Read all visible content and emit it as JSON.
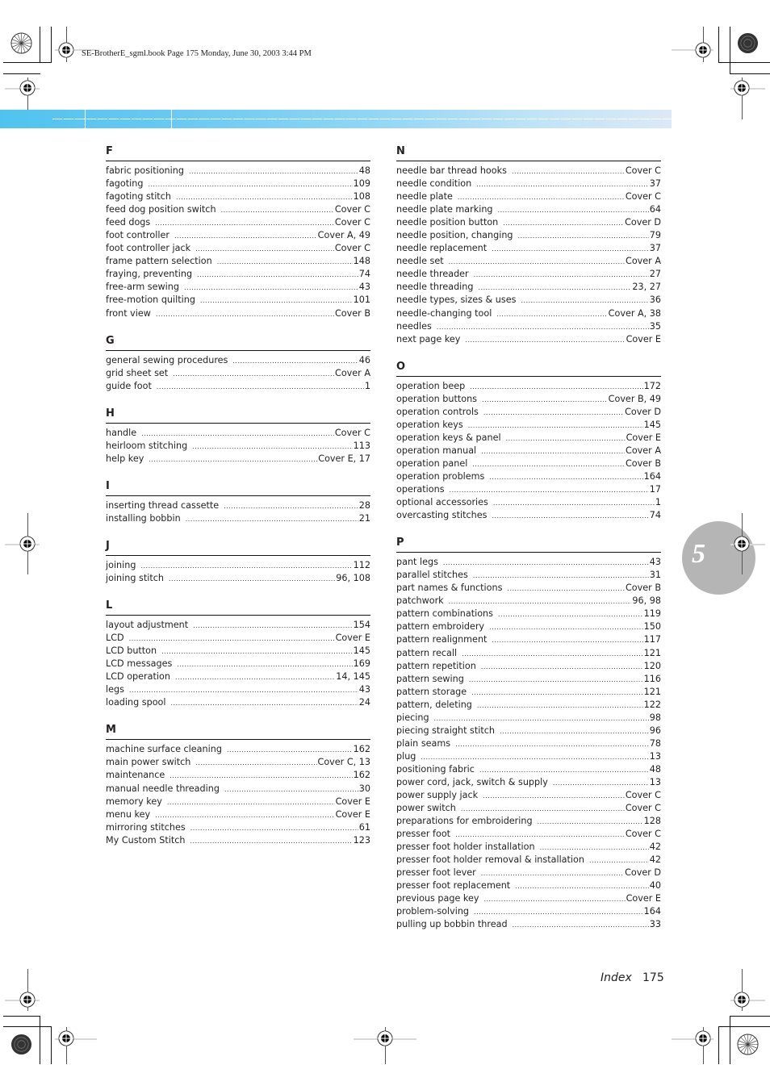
{
  "header": {
    "meta": "SE-BrotherE_sgml.book  Page 175  Monday, June 30, 2003  3:44 PM"
  },
  "chapter_tab": {
    "number": "5",
    "color": "#b5b5b6"
  },
  "band_colors": {
    "start": "#4fc3f0",
    "end": "#dbe9f7"
  },
  "footer": {
    "label": "Index",
    "page_number": "175"
  },
  "index": {
    "left": [
      {
        "letter": "F",
        "entries": [
          {
            "term": "fabric positioning",
            "page": "48"
          },
          {
            "term": "fagoting",
            "page": "109"
          },
          {
            "term": "fagoting stitch",
            "page": "108"
          },
          {
            "term": "feed dog position switch",
            "page": "Cover C"
          },
          {
            "term": "feed dogs",
            "page": "Cover C"
          },
          {
            "term": "foot controller",
            "page": "Cover A, 49"
          },
          {
            "term": "foot controller jack",
            "page": "Cover C"
          },
          {
            "term": "frame pattern selection",
            "page": "148"
          },
          {
            "term": "fraying, preventing",
            "page": "74"
          },
          {
            "term": "free-arm sewing",
            "page": "43"
          },
          {
            "term": "free-motion quilting",
            "page": "101"
          },
          {
            "term": "front view",
            "page": "Cover B"
          }
        ]
      },
      {
        "letter": "G",
        "entries": [
          {
            "term": "general sewing procedures",
            "page": "46"
          },
          {
            "term": "grid sheet set",
            "page": "Cover A"
          },
          {
            "term": "guide foot",
            "page": "1"
          }
        ]
      },
      {
        "letter": "H",
        "entries": [
          {
            "term": "handle",
            "page": "Cover C"
          },
          {
            "term": "heirloom stitching",
            "page": "113"
          },
          {
            "term": "help key",
            "page": "Cover E, 17"
          }
        ]
      },
      {
        "letter": "I",
        "entries": [
          {
            "term": "inserting thread cassette",
            "page": "28"
          },
          {
            "term": "installing bobbin",
            "page": "21"
          }
        ]
      },
      {
        "letter": "J",
        "entries": [
          {
            "term": "joining",
            "page": "112"
          },
          {
            "term": "joining stitch",
            "page": "96, 108"
          }
        ]
      },
      {
        "letter": "L",
        "entries": [
          {
            "term": "layout adjustment",
            "page": "154"
          },
          {
            "term": "LCD",
            "page": "Cover E"
          },
          {
            "term": "LCD button",
            "page": "145"
          },
          {
            "term": "LCD messages",
            "page": "169"
          },
          {
            "term": "LCD operation",
            "page": "14, 145"
          },
          {
            "term": "legs",
            "page": "43"
          },
          {
            "term": "loading spool",
            "page": "24"
          }
        ]
      },
      {
        "letter": "M",
        "entries": [
          {
            "term": "machine surface cleaning",
            "page": "162"
          },
          {
            "term": "main power switch",
            "page": "Cover C, 13"
          },
          {
            "term": "maintenance",
            "page": "162"
          },
          {
            "term": "manual needle threading",
            "page": "30"
          },
          {
            "term": "memory key",
            "page": "Cover E"
          },
          {
            "term": "menu key",
            "page": "Cover E"
          },
          {
            "term": "mirroring stitches",
            "page": "61"
          },
          {
            "term": "My Custom Stitch",
            "page": "123"
          }
        ]
      }
    ],
    "right": [
      {
        "letter": "N",
        "entries": [
          {
            "term": "needle bar thread hooks",
            "page": "Cover C"
          },
          {
            "term": "needle condition",
            "page": "37"
          },
          {
            "term": "needle plate",
            "page": "Cover C"
          },
          {
            "term": "needle plate marking",
            "page": "64"
          },
          {
            "term": "needle position button",
            "page": "Cover D"
          },
          {
            "term": "needle position, changing",
            "page": "79"
          },
          {
            "term": "needle replacement",
            "page": "37"
          },
          {
            "term": "needle set",
            "page": "Cover A"
          },
          {
            "term": "needle threader",
            "page": "27"
          },
          {
            "term": "needle threading",
            "page": "23, 27"
          },
          {
            "term": "needle types, sizes & uses",
            "page": "36"
          },
          {
            "term": "needle-changing tool",
            "page": "Cover A, 38"
          },
          {
            "term": "needles",
            "page": "35"
          },
          {
            "term": "next page key",
            "page": "Cover E"
          }
        ]
      },
      {
        "letter": "O",
        "entries": [
          {
            "term": "operation beep",
            "page": "172"
          },
          {
            "term": "operation buttons",
            "page": "Cover B, 49"
          },
          {
            "term": "operation controls",
            "page": "Cover D"
          },
          {
            "term": "operation keys",
            "page": "145"
          },
          {
            "term": "operation keys & panel",
            "page": "Cover E"
          },
          {
            "term": "operation manual",
            "page": "Cover A"
          },
          {
            "term": "operation panel",
            "page": "Cover B"
          },
          {
            "term": "operation problems",
            "page": "164"
          },
          {
            "term": "operations",
            "page": "17"
          },
          {
            "term": "optional accessories",
            "page": "1"
          },
          {
            "term": "overcasting stitches",
            "page": "74"
          }
        ]
      },
      {
        "letter": "P",
        "entries": [
          {
            "term": "pant legs",
            "page": "43"
          },
          {
            "term": "parallel stitches",
            "page": "31"
          },
          {
            "term": "part names & functions",
            "page": "Cover B"
          },
          {
            "term": "patchwork",
            "page": "96, 98"
          },
          {
            "term": "pattern combinations",
            "page": "119"
          },
          {
            "term": "pattern embroidery",
            "page": "150"
          },
          {
            "term": "pattern realignment",
            "page": "117"
          },
          {
            "term": "pattern recall",
            "page": "121"
          },
          {
            "term": "pattern repetition",
            "page": "120"
          },
          {
            "term": "pattern sewing",
            "page": "116"
          },
          {
            "term": "pattern storage",
            "page": "121"
          },
          {
            "term": "pattern, deleting",
            "page": "122"
          },
          {
            "term": "piecing",
            "page": "98"
          },
          {
            "term": "piecing straight stitch",
            "page": "96"
          },
          {
            "term": "plain seams",
            "page": "78"
          },
          {
            "term": "plug",
            "page": "13"
          },
          {
            "term": "positioning fabric",
            "page": "48"
          },
          {
            "term": "power cord, jack, switch & supply",
            "page": "13"
          },
          {
            "term": "power supply jack",
            "page": "Cover C"
          },
          {
            "term": "power switch",
            "page": "Cover C"
          },
          {
            "term": "preparations for embroidering",
            "page": "128"
          },
          {
            "term": "presser foot",
            "page": "Cover C"
          },
          {
            "term": "presser foot holder installation",
            "page": "42"
          },
          {
            "term": "presser foot holder removal & installation",
            "page": "42"
          },
          {
            "term": "presser foot lever",
            "page": "Cover D"
          },
          {
            "term": "presser foot replacement",
            "page": "40"
          },
          {
            "term": "previous page key",
            "page": "Cover E"
          },
          {
            "term": "problem-solving",
            "page": "164"
          },
          {
            "term": "pulling up bobbin thread",
            "page": "33"
          }
        ]
      }
    ]
  }
}
